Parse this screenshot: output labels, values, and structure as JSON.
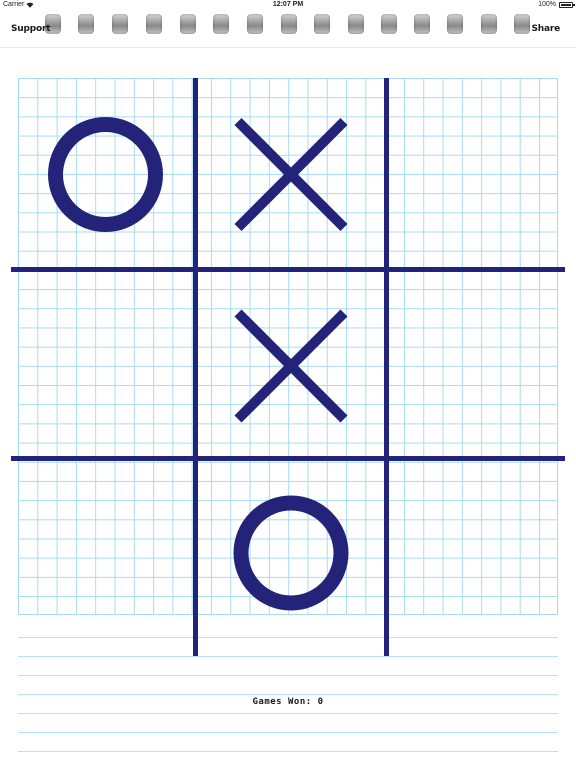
{
  "status_bar": {
    "carrier": "Carrier",
    "time": "12:07 PM",
    "battery": "100%"
  },
  "nav": {
    "support_label": "Support",
    "share_label": "Share"
  },
  "board": {
    "cells": [
      "O",
      "X",
      "",
      "",
      "X",
      "",
      "",
      "O",
      ""
    ]
  },
  "footer": {
    "games_won_label": "Games Won:",
    "games_won_value": "0"
  },
  "colors": {
    "mark_color": "#23237a",
    "grid_color": "#a6dcf2"
  },
  "icons": {
    "wifi": "wifi-icon",
    "battery": "battery-icon",
    "ring": "spiral-ring-icon"
  }
}
